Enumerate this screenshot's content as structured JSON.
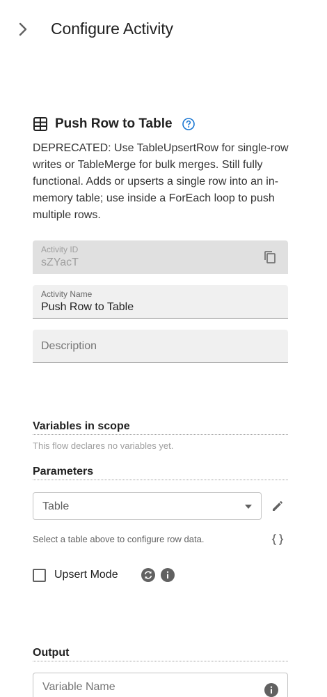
{
  "header": {
    "title": "Configure Activity",
    "collapse_icon": "chevron-right-icon"
  },
  "activity": {
    "icon": "table-grid-icon",
    "title": "Push Row to Table",
    "help_icon": "help-circle-icon",
    "description": "DEPRECATED: Use TableUpsertRow for single-row writes or TableMerge for bulk merges. Still fully functional. Adds or upserts a single row into an in-memory table; use inside a ForEach loop to push multiple rows."
  },
  "fields": {
    "activity_id": {
      "label": "Activity ID",
      "value": "sZYacT",
      "disabled": true
    },
    "activity_name": {
      "label": "Activity Name",
      "value": "Push Row to Table"
    },
    "description": {
      "placeholder": "Description"
    }
  },
  "variables": {
    "title": "Variables in scope",
    "empty_text": "This flow declares no variables yet."
  },
  "parameters": {
    "title": "Parameters",
    "table_select": {
      "label": "Table",
      "value": ""
    },
    "select_hint": "Select a table above to configure row data.",
    "upsert_mode": {
      "label": "Upsert Mode",
      "checked": false
    }
  },
  "output": {
    "title": "Output",
    "variable_name": {
      "placeholder": "Variable Name"
    }
  },
  "colors": {
    "accent": "#1976d2",
    "icon_gray": "#616161",
    "field_bg": "#f0f0f0",
    "disabled_bg": "#e0e0e0"
  }
}
